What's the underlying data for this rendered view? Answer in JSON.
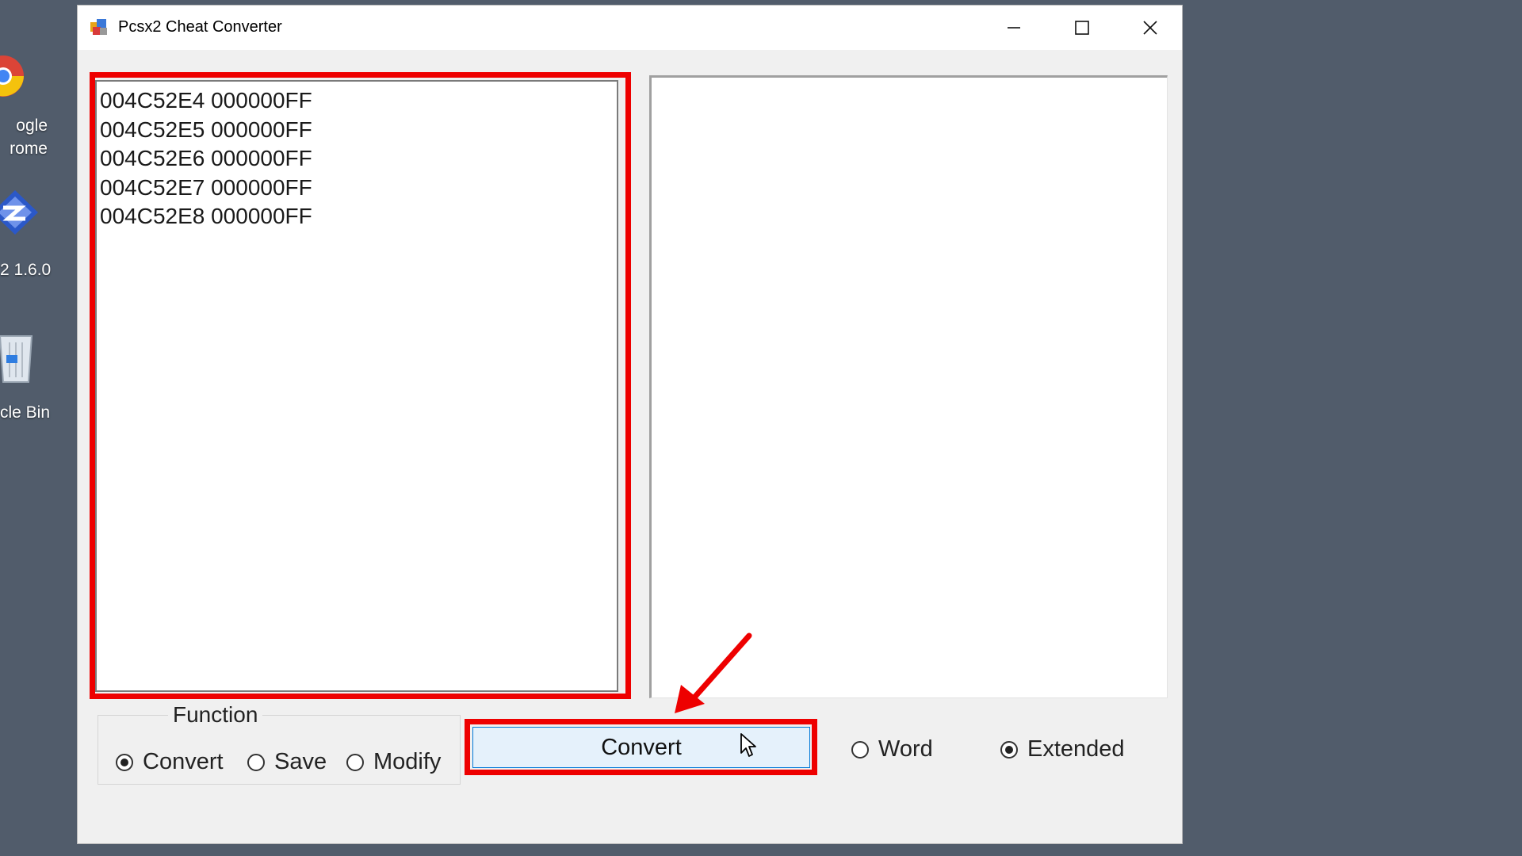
{
  "desktop": {
    "icons": [
      {
        "line1": "ogle",
        "line2": "rome"
      },
      {
        "line1": "2 1.6.0"
      },
      {
        "line1": "cle Bin"
      }
    ]
  },
  "window": {
    "title": "Pcsx2 Cheat Converter",
    "input_lines": [
      "004C52E4 000000FF",
      "004C52E5 000000FF",
      "004C52E6 000000FF",
      "004C52E7 000000FF",
      "004C52E8 000000FF"
    ],
    "output_text": "",
    "function_group": {
      "legend": "Function",
      "options": [
        "Convert",
        "Save",
        "Modify"
      ],
      "selected": "Convert"
    },
    "convert_button": "Convert",
    "mode_options": {
      "word": "Word",
      "extended": "Extended",
      "selected": "Extended"
    }
  },
  "colors": {
    "highlight": "#ee0000",
    "desktop_bg": "#515c6b",
    "button_bg": "#e5f1fb"
  }
}
